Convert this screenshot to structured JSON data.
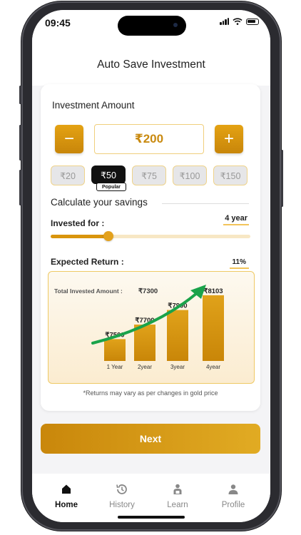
{
  "status_bar": {
    "time": "09:45"
  },
  "header": {
    "title": "Auto Save Investment"
  },
  "investment": {
    "title": "Investment Amount",
    "minus": "−",
    "plus": "+",
    "amount": "₹200",
    "chips": [
      "₹20",
      "₹50",
      "₹75",
      "₹100",
      "₹150"
    ],
    "selected_chip": "₹50",
    "popular_badge": "Popular"
  },
  "calculator": {
    "title": "Calculate your savings",
    "invested_for_label": "Invested for :",
    "invested_for_value": "4 year",
    "slider_fraction": 0.29,
    "expected_return_label": "Expected Return :",
    "expected_return_value": "11%"
  },
  "chart_data": {
    "type": "bar",
    "title": "",
    "summary_label": "Total Invested Amount :",
    "summary_value": "₹7300",
    "categories": [
      "1 Year",
      "2year",
      "3year",
      "4year"
    ],
    "values": [
      7500,
      7700,
      7900,
      8103
    ],
    "value_labels": [
      "₹7500",
      "₹7700",
      "₹7900",
      "₹8103"
    ],
    "bar_color": "#d4930c",
    "arrow_color": "#1aa34a"
  },
  "disclaimer": "*Returns may vary as per changes in gold price",
  "next_button": "Next",
  "tabs": [
    {
      "label": "Home",
      "icon": "home-icon",
      "active": true
    },
    {
      "label": "History",
      "icon": "history-icon",
      "active": false
    },
    {
      "label": "Learn",
      "icon": "learn-icon",
      "active": false
    },
    {
      "label": "Profile",
      "icon": "profile-icon",
      "active": false
    }
  ]
}
